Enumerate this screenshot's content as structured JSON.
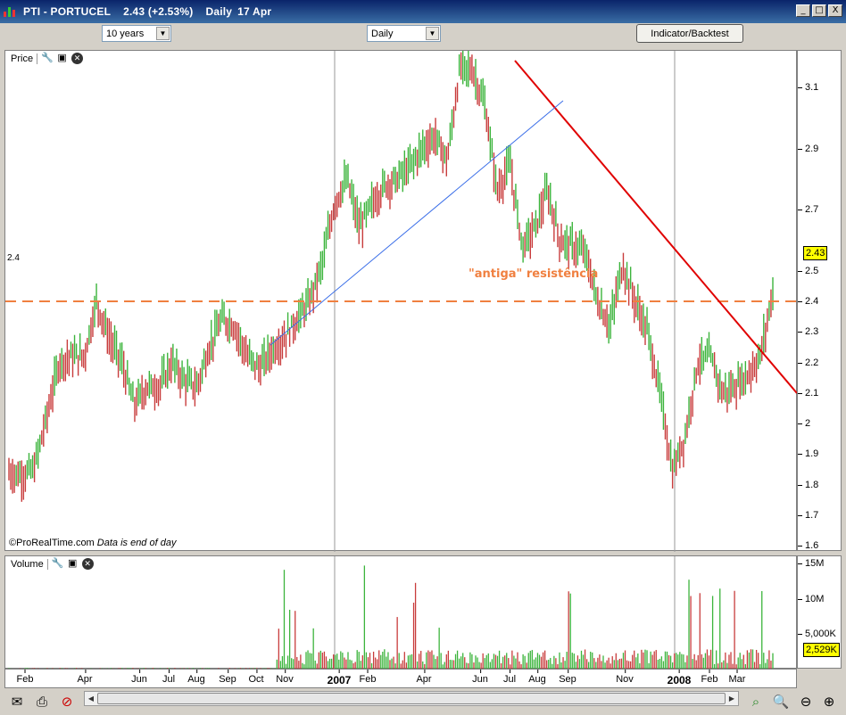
{
  "window": {
    "title": "PTI - PORTUCEL",
    "last_price": "2.43 (+2.53%)",
    "frequency": "Daily",
    "date": "17 Apr",
    "minimize": "_",
    "maximize": "□",
    "close": "X"
  },
  "toolbar": {
    "period": "10 years",
    "interval": "Daily",
    "indicator_button": "Indicator/Backtest"
  },
  "price_panel": {
    "label": "Price",
    "annotation": "\"antiga\" resistência",
    "resistance_label": "2.4",
    "last_badge": "2.43",
    "watermark": "©ProRealTime.com",
    "watermark_note": "Data is end of day"
  },
  "volume_panel": {
    "label": "Volume",
    "last_badge": "2,529K"
  },
  "colors": {
    "up": "#3cb43c",
    "down": "#c83c3c",
    "trend_down": "#e00000",
    "trend_up": "#3a6ee8",
    "resistance": "#f08040"
  },
  "icons": [
    "wrench-icon",
    "window-icon",
    "close-icon",
    "mail-icon",
    "print-icon",
    "no-zoom-icon",
    "chart-search-icon",
    "zoom-search-icon",
    "zoom-out-icon",
    "zoom-in-icon"
  ],
  "chart_data": {
    "type": "candlestick",
    "price_axis": {
      "ticks": [
        "3.1",
        "2.9",
        "2.7",
        "2.5",
        "2.4",
        "2.3",
        "2.2",
        "2.1",
        "2",
        "1.9",
        "1.8",
        "1.7",
        "1.6"
      ],
      "range": [
        1.58,
        3.22
      ]
    },
    "volume_axis": {
      "ticks": [
        "15M",
        "10M",
        "5,000K"
      ],
      "range": [
        0,
        16000000
      ]
    },
    "x_labels": [
      "Feb",
      "Apr",
      "Jun",
      "Jul",
      "Aug",
      "Sep",
      "Oct",
      "Nov",
      "2007",
      "Feb",
      "Apr",
      "Jun",
      "Jul",
      "Aug",
      "Sep",
      "Nov",
      "2008",
      "Feb",
      "Mar"
    ],
    "close_series": [
      1.84,
      1.83,
      1.85,
      2.02,
      2.2,
      2.22,
      2.22,
      2.4,
      2.28,
      2.2,
      2.06,
      2.12,
      2.12,
      2.2,
      2.14,
      2.12,
      2.25,
      2.34,
      2.32,
      2.22,
      2.18,
      2.24,
      2.28,
      2.34,
      2.4,
      2.52,
      2.72,
      2.8,
      2.64,
      2.72,
      2.78,
      2.8,
      2.84,
      2.9,
      2.94,
      2.86,
      3.16,
      3.16,
      3.04,
      2.76,
      2.85,
      2.58,
      2.64,
      2.76,
      2.6,
      2.58,
      2.56,
      2.4,
      2.32,
      2.52,
      2.4,
      2.3,
      2.1,
      1.84,
      1.96,
      2.2,
      2.22,
      2.1,
      2.12,
      2.16,
      2.22,
      2.43
    ],
    "resistance_level": 2.4,
    "trendline_down": [
      {
        "x": "Jul 2007",
        "y": 3.19
      },
      {
        "x": "Apr 2008",
        "y": 2.0
      }
    ],
    "trendline_up": [
      {
        "x": "Nov 2006",
        "y": 2.15
      },
      {
        "x": "Aug 2007",
        "y": 3.02
      }
    ]
  }
}
